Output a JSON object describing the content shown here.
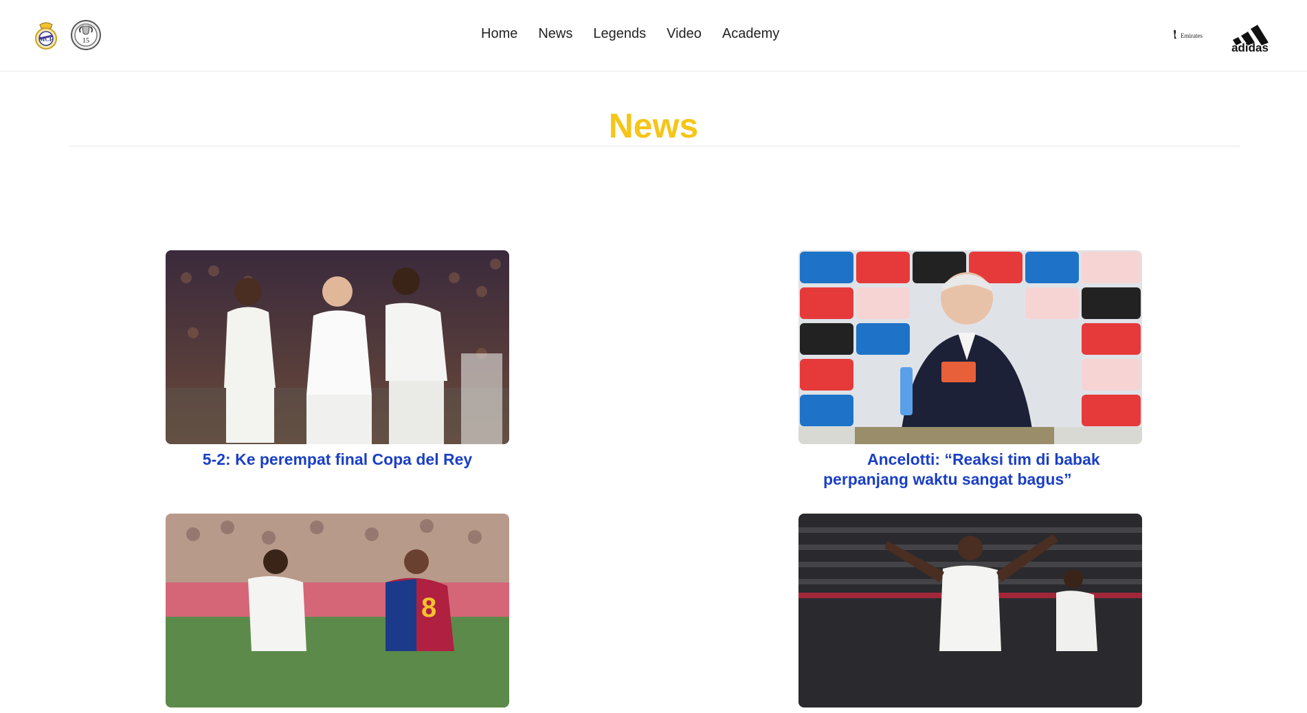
{
  "header": {
    "logos": [
      {
        "icon": "real-madrid-crest-icon"
      },
      {
        "icon": "ucl-15-trophy-badge-icon",
        "text": "15"
      }
    ],
    "nav": [
      {
        "label": "Home"
      },
      {
        "label": "News"
      },
      {
        "label": "Legends"
      },
      {
        "label": "Video"
      },
      {
        "label": "Academy"
      }
    ],
    "sponsors": [
      {
        "icon": "emirates-logo-icon",
        "text": "Emirates"
      },
      {
        "icon": "adidas-logo-icon",
        "text": "adidas"
      }
    ]
  },
  "page": {
    "title": "News",
    "title_color": "#f5c518"
  },
  "articles": [
    {
      "title": "5-2: Ke perempat final Copa del Rey",
      "image": "players-celebrating-photo"
    },
    {
      "title": "Ancelotti: “Reaksi tim di babak perpanjang waktu sangat bagus”",
      "image": "press-conference-photo"
    },
    {
      "title": "",
      "image": "match-action-photo"
    },
    {
      "title": "",
      "image": "player-celebration-stadium-photo"
    }
  ],
  "colors": {
    "accent": "#f5c518",
    "link": "#1a3fc4"
  }
}
